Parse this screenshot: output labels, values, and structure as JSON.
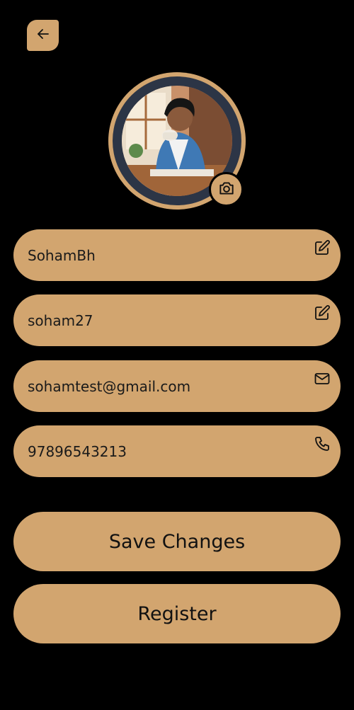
{
  "profile": {
    "username": "SohamBh",
    "handle": "soham27",
    "email": "sohamtest@gmail.com",
    "phone": "97896543213"
  },
  "buttons": {
    "save_label": "Save Changes",
    "register_label": "Register"
  },
  "icons": {
    "back": "arrow-left-icon",
    "camera": "camera-icon",
    "edit": "edit-icon",
    "mail": "mail-icon",
    "phone": "phone-icon"
  },
  "colors": {
    "background": "#000000",
    "accent": "#d2a56f",
    "avatar_border": "#2c3546",
    "text": "#111111"
  }
}
